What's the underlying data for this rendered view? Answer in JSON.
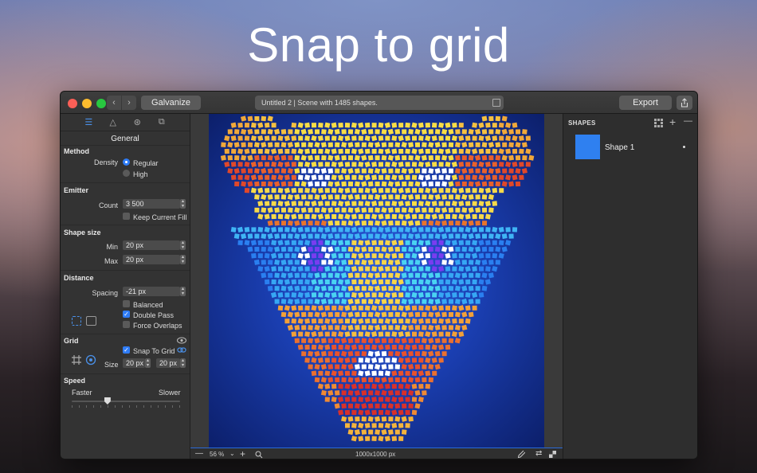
{
  "hero": {
    "title": "Snap to grid"
  },
  "window": {
    "app_button": "Galvanize",
    "document_title": "Untitled 2 | Scene with 1485 shapes.",
    "export_button": "Export"
  },
  "sidebar": {
    "header": "General",
    "method": {
      "title": "Method",
      "density_label": "Density",
      "regular": "Regular",
      "high": "High",
      "selected": "Regular"
    },
    "emitter": {
      "title": "Emitter",
      "count_label": "Count",
      "count_value": "3 500",
      "keep_fill_label": "Keep Current Fill",
      "keep_fill_checked": false
    },
    "shape_size": {
      "title": "Shape size",
      "min_label": "Min",
      "min_value": "20 px",
      "max_label": "Max",
      "max_value": "20 px"
    },
    "distance": {
      "title": "Distance",
      "spacing_label": "Spacing",
      "spacing_value": "-21 px",
      "balanced_label": "Balanced",
      "balanced_checked": false,
      "double_pass_label": "Double Pass",
      "double_pass_checked": true,
      "force_overlaps_label": "Force Overlaps",
      "force_overlaps_checked": false
    },
    "grid": {
      "title": "Grid",
      "snap_label": "Snap To Grid",
      "snap_checked": true,
      "size_label": "Size",
      "size_x": "20 px",
      "size_y": "20 px"
    },
    "speed": {
      "title": "Speed",
      "faster": "Faster",
      "slower": "Slower",
      "value_fraction": 0.33
    }
  },
  "canvas": {
    "zoom": "56 %",
    "dimensions": "1000x1000 px"
  },
  "shapes_panel": {
    "title": "SHAPES",
    "items": [
      {
        "name": "Shape 1",
        "color": "#2f80f0"
      }
    ]
  },
  "colors": {
    "accent": "#2f7cf6"
  }
}
